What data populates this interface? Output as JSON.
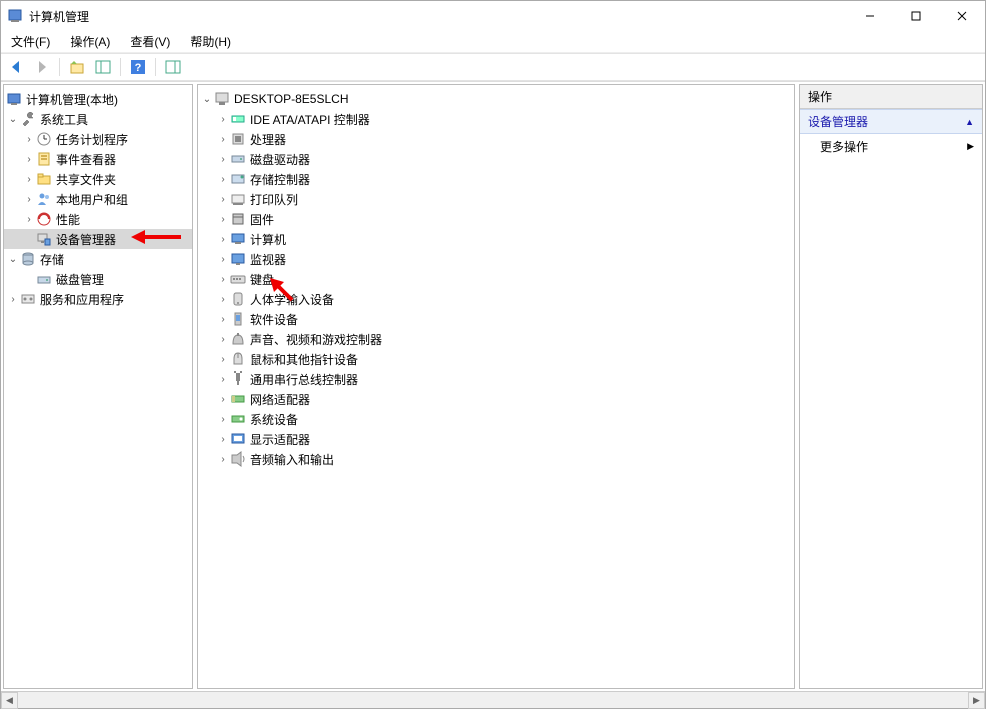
{
  "window": {
    "title": "计算机管理"
  },
  "menu": {
    "file": "文件(F)",
    "action": "操作(A)",
    "view": "查看(V)",
    "help": "帮助(H)"
  },
  "actions": {
    "header": "操作",
    "group": "设备管理器",
    "more": "更多操作"
  },
  "left_tree": {
    "root": "计算机管理(本地)",
    "sys_tools": "系统工具",
    "task_scheduler": "任务计划程序",
    "event_viewer": "事件查看器",
    "shared_folders": "共享文件夹",
    "local_users": "本地用户和组",
    "performance": "性能",
    "device_manager": "设备管理器",
    "storage": "存储",
    "disk_mgmt": "磁盘管理",
    "services_apps": "服务和应用程序"
  },
  "device_tree": {
    "computer_name": "DESKTOP-8E5SLCH",
    "categories": [
      "IDE ATA/ATAPI 控制器",
      "处理器",
      "磁盘驱动器",
      "存储控制器",
      "打印队列",
      "固件",
      "计算机",
      "监视器",
      "键盘",
      "人体学输入设备",
      "软件设备",
      "声音、视频和游戏控制器",
      "鼠标和其他指针设备",
      "通用串行总线控制器",
      "网络适配器",
      "系统设备",
      "显示适配器",
      "音频输入和输出"
    ]
  }
}
